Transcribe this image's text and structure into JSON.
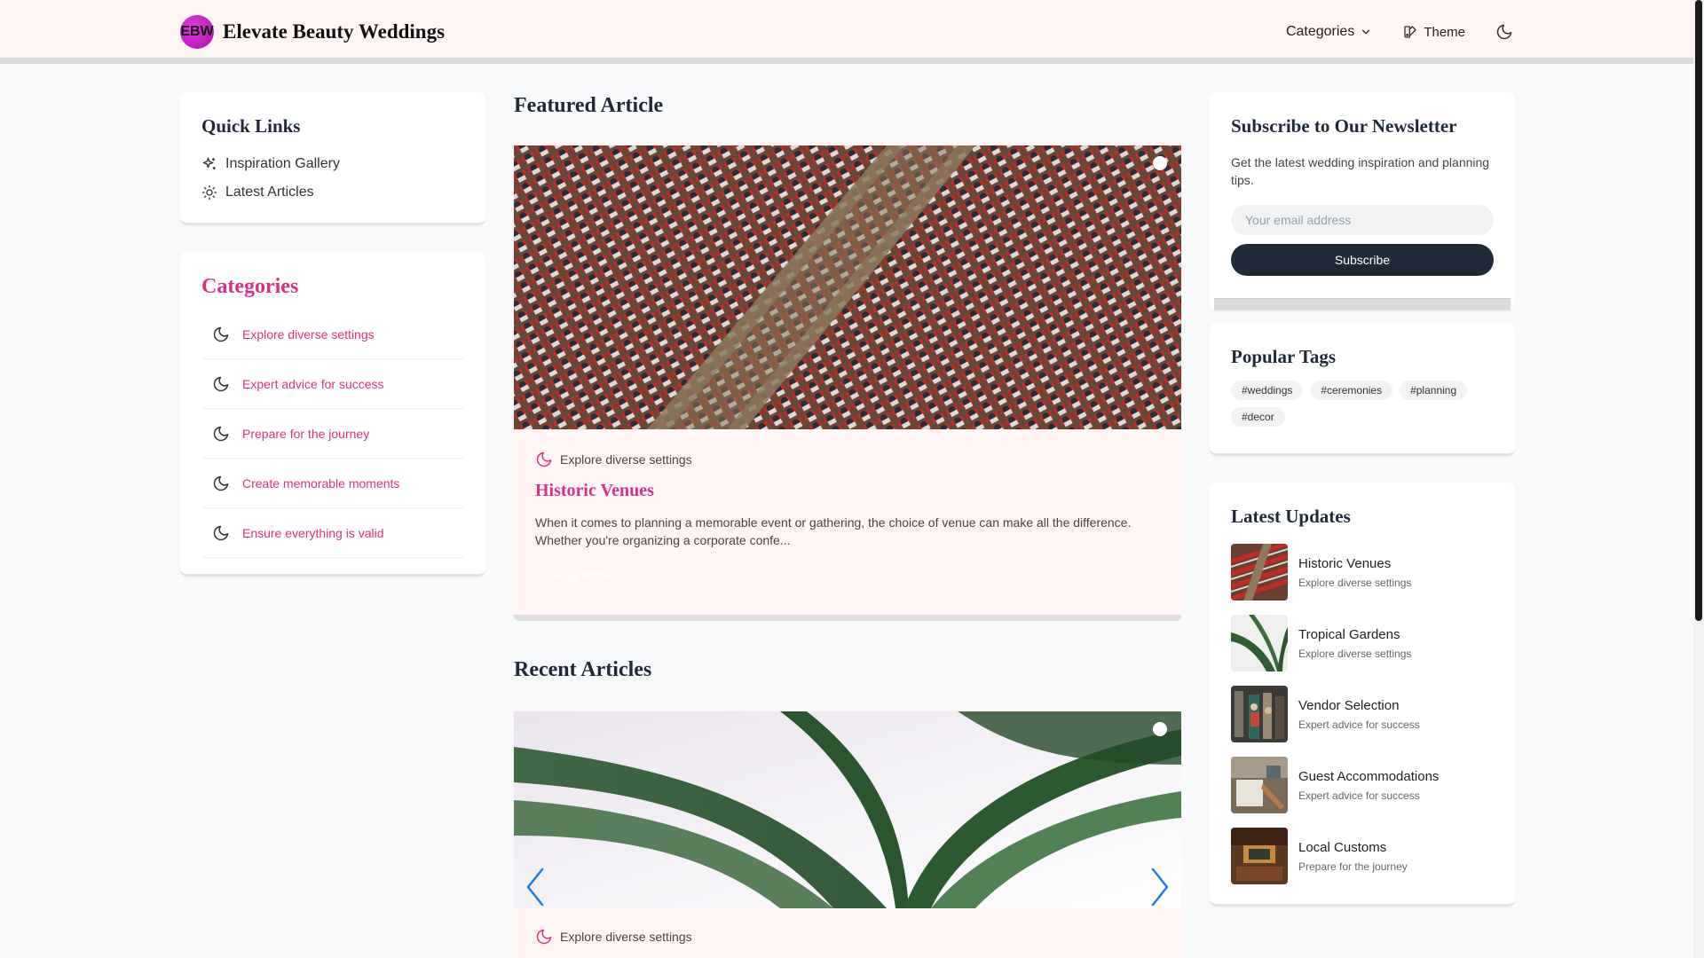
{
  "header": {
    "logo_text": "EBW",
    "brand": "Elevate Beauty Weddings",
    "nav": {
      "categories": "Categories",
      "theme": "Theme"
    }
  },
  "quick_links": {
    "title": "Quick Links",
    "items": [
      {
        "label": "Inspiration Gallery",
        "icon": "sparkles-icon"
      },
      {
        "label": "Latest Articles",
        "icon": "sun-icon"
      }
    ]
  },
  "categories": {
    "title": "Categories",
    "items": [
      "Explore diverse settings",
      "Expert advice for success",
      "Prepare for the journey",
      "Create memorable moments",
      "Ensure everything is valid"
    ]
  },
  "featured": {
    "section_title": "Featured Article",
    "category": "Explore diverse settings",
    "title": "Historic Venues",
    "excerpt": "When it comes to planning a memorable event or gathering, the choice of venue can make all the difference. Whether you're organizing a corporate confe...",
    "read_more": "Read More"
  },
  "recent": {
    "section_title": "Recent Articles",
    "category": "Explore diverse settings"
  },
  "newsletter": {
    "title": "Subscribe to Our Newsletter",
    "text": "Get the latest wedding inspiration and planning tips.",
    "placeholder": "Your email address",
    "button": "Subscribe"
  },
  "tags": {
    "title": "Popular Tags",
    "items": [
      "#weddings",
      "#ceremonies",
      "#planning",
      "#decor"
    ]
  },
  "updates": {
    "title": "Latest Updates",
    "items": [
      {
        "title": "Historic Venues",
        "sub": "Explore diverse settings"
      },
      {
        "title": "Tropical Gardens",
        "sub": "Explore diverse settings"
      },
      {
        "title": "Vendor Selection",
        "sub": "Expert advice for success"
      },
      {
        "title": "Guest Accommodations",
        "sub": "Expert advice for success"
      },
      {
        "title": "Local Customs",
        "sub": "Prepare for the journey"
      }
    ]
  },
  "colors": {
    "accent": "#d63384",
    "header_bg": "#fff5f5",
    "button_dark": "#1f2937",
    "logo": "#c21bc4"
  }
}
